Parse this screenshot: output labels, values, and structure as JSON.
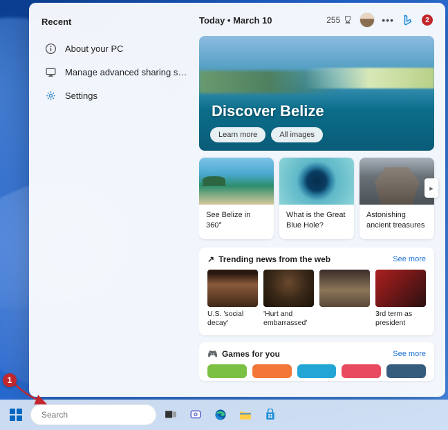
{
  "recent": {
    "title": "Recent",
    "items": [
      {
        "icon": "info",
        "label": "About your PC"
      },
      {
        "icon": "monitor",
        "label": "Manage advanced sharing settin..."
      },
      {
        "icon": "gear",
        "label": "Settings"
      }
    ]
  },
  "header": {
    "today": "Today  •  March 10",
    "points": "255",
    "badge": "2"
  },
  "hero": {
    "title": "Discover Belize",
    "learn": "Learn more",
    "all": "All images"
  },
  "cards": [
    {
      "caption": "See Belize in 360°",
      "imgClass": "img-beach"
    },
    {
      "caption": "What is the Great Blue Hole?",
      "imgClass": "img-bluehole"
    },
    {
      "caption": "Astonishing ancient treasures",
      "imgClass": "img-ruins"
    }
  ],
  "trending": {
    "title": "Trending news from the web",
    "see_more": "See more",
    "items": [
      {
        "caption": "U.S. 'social decay'",
        "imgClass": "img-person1"
      },
      {
        "caption": "'Hurt and embarrassed'",
        "imgClass": "img-person2"
      },
      {
        "caption": "",
        "imgClass": "img-person3"
      },
      {
        "caption": "3rd term as president",
        "imgClass": "img-person4"
      }
    ]
  },
  "games": {
    "title": "Games for you",
    "see_more": "See more",
    "tiles": [
      "#7bc043",
      "#f37736",
      "#23a6d5",
      "#e84a5f",
      "#355c7d"
    ]
  },
  "taskbar": {
    "search_placeholder": "Search"
  },
  "annotations": {
    "callout1": "1",
    "callout2_is_in_header_badge": true
  }
}
